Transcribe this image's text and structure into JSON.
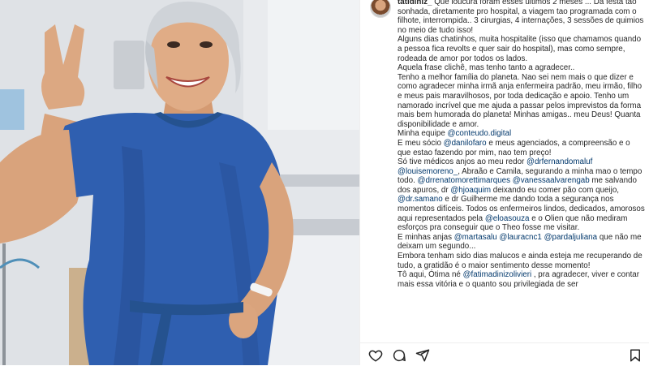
{
  "post": {
    "username": "tatidiniz_",
    "caption_lines": [
      " Que loucura foram esses últimos 2 meses ... Da festa tao sonhada, diretamente pro hospital, a viagem tao programada com o filhote, interrompida.. 3 cirurgias, 4 internações, 3 sessões de quimios no meio de tudo isso!",
      "Alguns dias chatinhos, muita hospitalite (isso que chamamos quando a pessoa fica revolts e quer sair do hospital), mas como sempre, rodeada de amor por todos os lados.",
      "Aquela frase clichê, mas tenho tanto a agradecer..",
      "Tenho a melhor família do planeta. Nao sei nem mais o que dizer e como agradecer minha irmã anja enfermeira padrão, meu irmão, filho e meus pais maravilhosos, por toda dedicação e apoio. Tenho um namorado incrível que me ajuda a passar pelos imprevistos da forma mais bem humorada do planeta! Minhas amigas.. meu Deus! Quanta disponibilidade e amor."
    ],
    "team_prefix": "Minha equipe ",
    "team_mention": "@conteudo.digital",
    "partner_prefix": "E meu sócio ",
    "partner_mention": "@danilofaro",
    "partner_suffix": " e meus agenciados, a compreensão e o que estao fazendo por mim, nao tem preço!",
    "doctors_prefix": "Só tive médicos anjos ao meu redor ",
    "doctor_1": "@drfernandomaluf",
    "doctor_2": "@louisemoreno_",
    "doctors_mid": ", Abraão e Camila, segurando a minha mao o tempo todo. ",
    "doctor_3": "@drrenatomorettimarques",
    "doctor_4": "@vanessaalvarengab",
    "doctors_mid2": " me salvando dos apuros, dr ",
    "doctor_5": "@hjoaquim",
    "doctors_mid3": " deixando eu comer pão com queijo, ",
    "doctor_6": "@dr.samano",
    "doctors_end": " e dr Guilherme me dando toda a segurança nos momentos difíceis. Todos os enfermeiros lindos, dedicados, amorosos aqui representados pela ",
    "nurse_mention": "@eloasouza",
    "nurses_end": " e o Olien que não mediram esforços pra conseguir que o Theo fosse me visitar.",
    "angels_prefix": "E minhas anjas ",
    "angel_1": "@martasalu",
    "angel_2": "@lauracnc1",
    "angel_3": "@pardaljuliana",
    "angels_end": " que não me deixam um segundo...",
    "closing_1": "Embora tenham sido dias malucos e ainda esteja me recuperando de tudo, a gratidão é o maior sentimento desse momento!",
    "closing_prefix": "Tô aqui, Ótima né ",
    "closing_mention": "@fatimadinizolivieri",
    "closing_end": " , pra agradecer, viver e contar mais essa vitória e o quanto sou privilegiada de ser"
  },
  "icons": {
    "like": "heart-icon",
    "comment": "comment-icon",
    "share": "share-icon",
    "save": "bookmark-icon"
  },
  "colors": {
    "text": "#262626",
    "mention": "#00376b",
    "gown": "#2f5fb0"
  }
}
